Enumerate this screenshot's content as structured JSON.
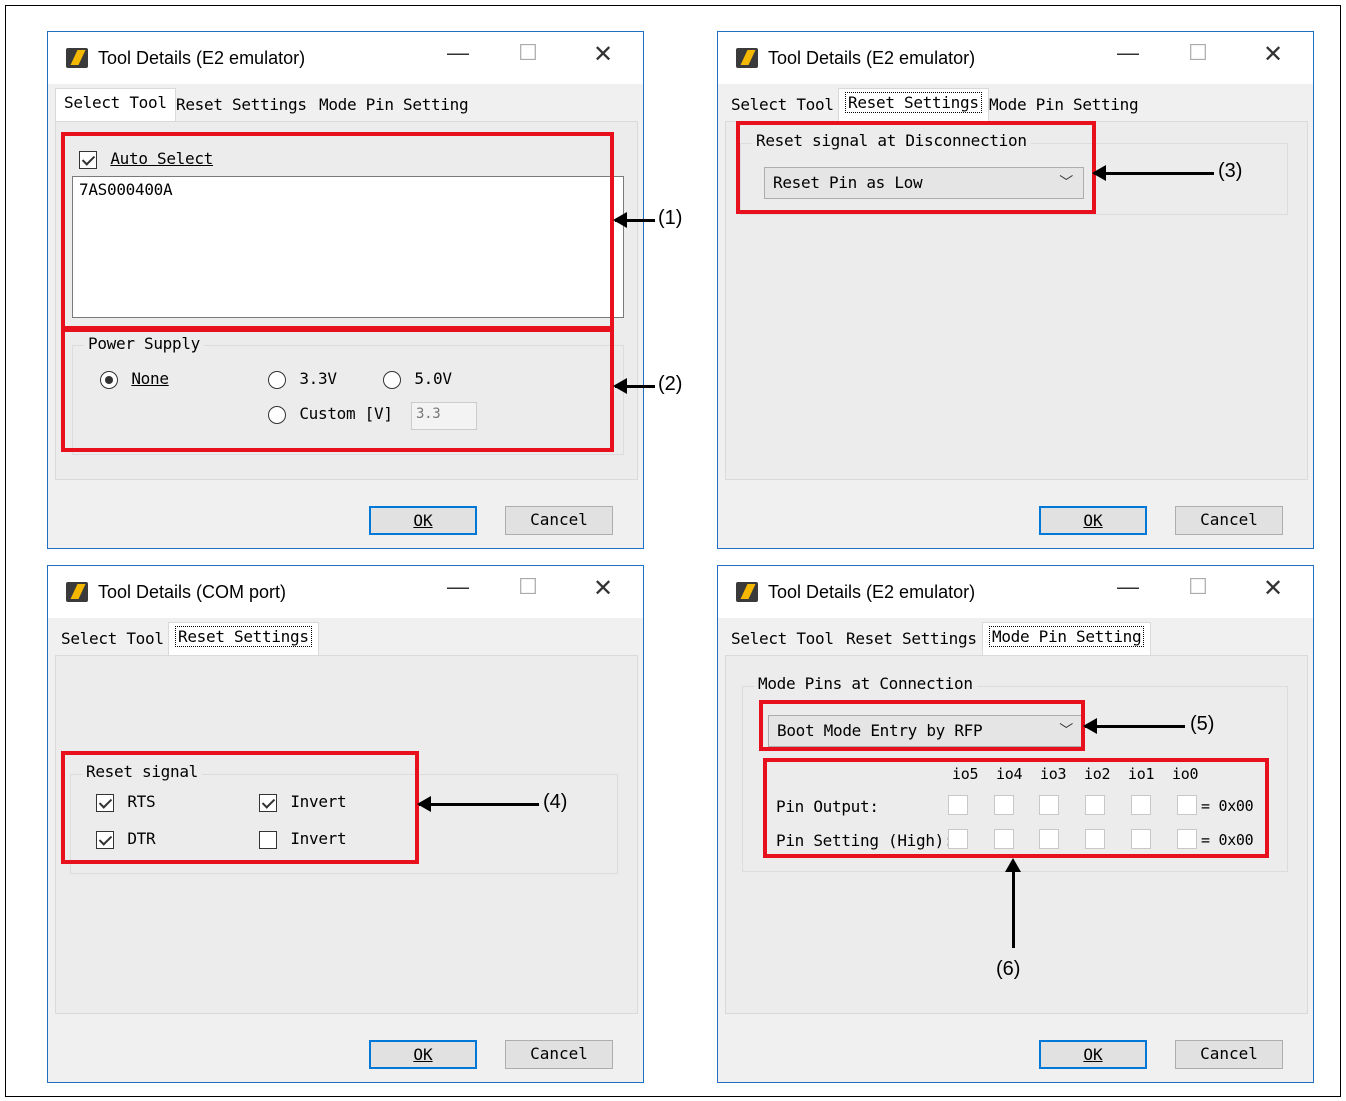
{
  "windows": [
    {
      "title": "Tool Details (E2 emulator)",
      "tabs": [
        "Select Tool",
        "Reset Settings",
        "Mode Pin Setting"
      ],
      "ok": "OK",
      "cancel": "Cancel"
    },
    {
      "title": "Tool Details (E2 emulator)",
      "tabs": [
        "Select Tool",
        "Reset Settings",
        "Mode Pin Setting"
      ],
      "ok": "OK",
      "cancel": "Cancel"
    },
    {
      "title": "Tool Details (COM port)",
      "tabs": [
        "Select Tool",
        "Reset Settings"
      ],
      "ok": "OK",
      "cancel": "Cancel"
    },
    {
      "title": "Tool Details (E2 emulator)",
      "tabs": [
        "Select Tool",
        "Reset Settings",
        "Mode Pin Setting"
      ],
      "ok": "OK",
      "cancel": "Cancel"
    }
  ],
  "win_controls": {
    "minimize": "—",
    "maximize": "☐",
    "close": "✕"
  },
  "select_tool": {
    "auto_select": "Auto Select",
    "auto_select_checked": true,
    "tool_list": [
      "7AS000400A"
    ],
    "power_supply": {
      "label": "Power Supply",
      "none": "None",
      "v33": "3.3V",
      "v50": "5.0V",
      "custom": "Custom [V]",
      "custom_value": "3.3",
      "selected": "None"
    }
  },
  "reset_settings": {
    "group_label": "Reset signal at Disconnection",
    "selected": "Reset Pin as Low"
  },
  "com_reset": {
    "group_label": "Reset signal",
    "rts": "RTS",
    "dtr": "DTR",
    "invert1": "Invert",
    "invert2": "Invert",
    "rts_checked": true,
    "dtr_checked": true,
    "invert1_checked": true,
    "invert2_checked": false
  },
  "mode_pin": {
    "group_label": "Mode Pins at Connection",
    "selected": "Boot Mode Entry by RFP",
    "pins": [
      "io5",
      "io4",
      "io3",
      "io2",
      "io1",
      "io0"
    ],
    "pin_output": "Pin Output:",
    "pin_setting": "Pin Setting (High):",
    "output_value": "= 0x00",
    "setting_value": "= 0x00"
  },
  "callouts": [
    "(1)",
    "(2)",
    "(3)",
    "(4)",
    "(5)",
    "(6)"
  ],
  "colors": {
    "highlight": "#e8101c",
    "accent": "#0078d7"
  }
}
